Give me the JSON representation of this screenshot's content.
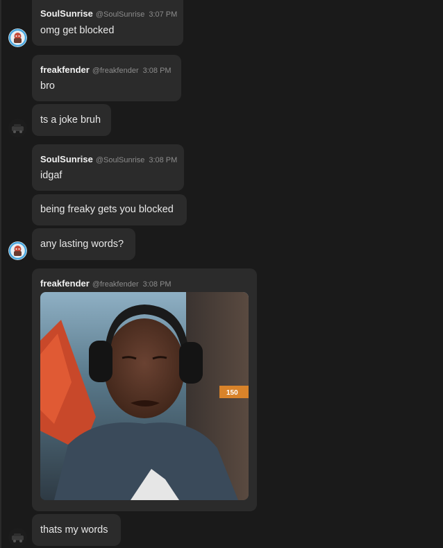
{
  "messages": [
    {
      "type": "header",
      "name": "SoulSunrise",
      "handle": "@SoulSunrise",
      "time": "3:07 PM",
      "text": "omg get blocked"
    },
    {
      "type": "header",
      "name": "freakfender",
      "handle": "@freakfender",
      "time": "3:08 PM",
      "text": "bro"
    },
    {
      "type": "plain",
      "text": "ts a joke bruh"
    },
    {
      "type": "header",
      "name": "SoulSunrise",
      "handle": "@SoulSunrise",
      "time": "3:08 PM",
      "text": "idgaf"
    },
    {
      "type": "plain",
      "text": "being freaky gets you blocked"
    },
    {
      "type": "plain",
      "text": "any lasting words?"
    },
    {
      "type": "media",
      "name": "freakfender",
      "handle": "@freakfender",
      "time": "3:08 PM",
      "overlay_text": "150"
    },
    {
      "type": "plain",
      "text": "thats my words"
    }
  ],
  "avatars": {
    "soulsunrise": {
      "icon": "soulsunrise-avatar-icon",
      "ring_color": "#4aa8e0"
    },
    "freakfender": {
      "icon": "freakfender-avatar-icon",
      "color": "#1c1c1c"
    }
  },
  "colors": {
    "background": "#1a1a1a",
    "bubble": "#2b2b2b",
    "name": "#f2f2f2",
    "meta": "#8c8c8c"
  }
}
